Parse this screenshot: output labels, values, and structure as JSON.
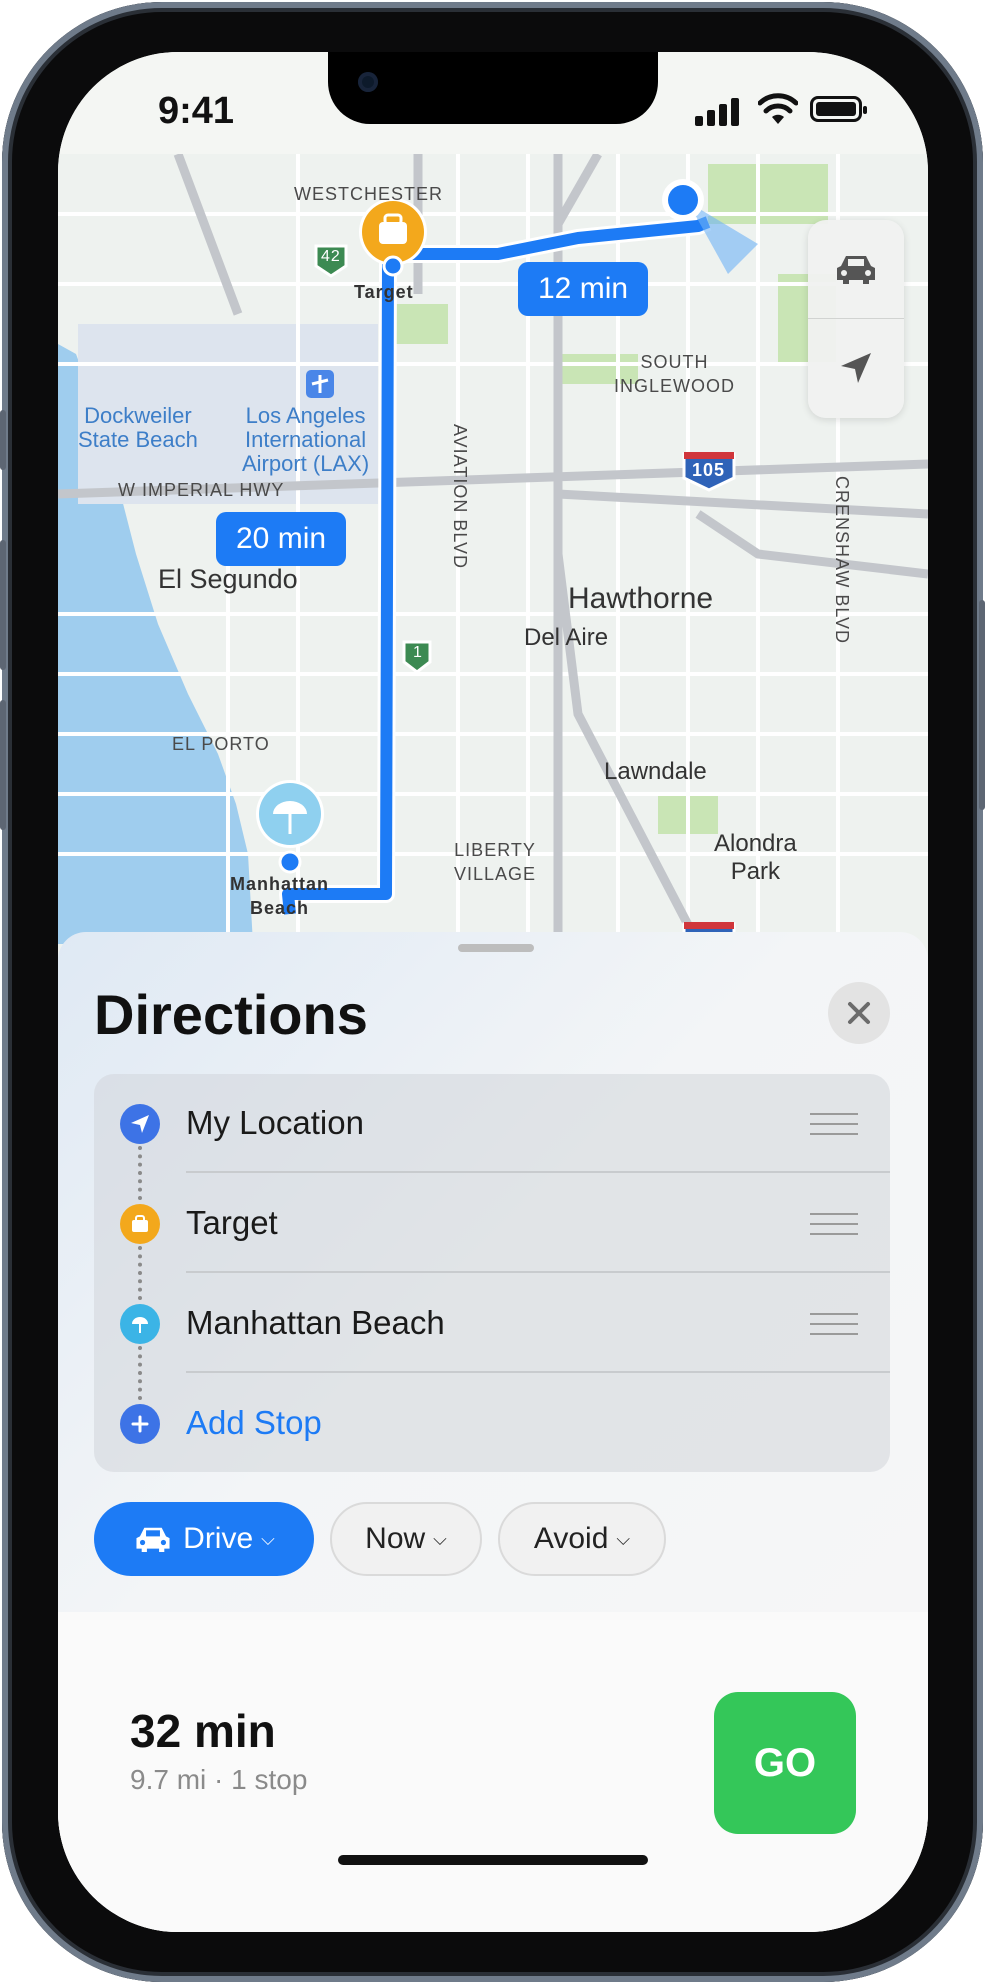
{
  "status": {
    "time": "9:41"
  },
  "map": {
    "labels": {
      "westchester": "WESTCHESTER",
      "target_pin": "Target",
      "south_inglewood": "SOUTH\nINGLEWOOD",
      "dockweiler": "Dockweiler\nState Beach",
      "lax": "Los Angeles\nInternational\nAirport (LAX)",
      "imperial": "W IMPERIAL HWY",
      "el_segundo": "El Segundo",
      "hawthorne": "Hawthorne",
      "del_aire": "Del Aire",
      "el_porto": "EL PORTO",
      "lawndale": "Lawndale",
      "liberty_village": "LIBERTY\nVILLAGE",
      "alondra_park": "Alondra\nPark",
      "manhattan_beach": "Manhattan\nBeach",
      "aviation": "AVIATION BLVD",
      "crenshaw": "CRENSHAW BLVD",
      "shield_42": "42",
      "shield_105": "105",
      "shield_1": "1"
    },
    "bubbles": {
      "leg1": "12 min",
      "leg2": "20 min"
    },
    "colors": {
      "route": "#1d7bf5",
      "water": "#9fcdee",
      "park": "#c9e5b5",
      "land": "#eef2ef"
    }
  },
  "sheet": {
    "title": "Directions",
    "stops": [
      {
        "label": "My Location",
        "icon": "location-arrow-icon",
        "color": "#3d73e6"
      },
      {
        "label": "Target",
        "icon": "shopping-bag-icon",
        "color": "#f3a81c"
      },
      {
        "label": "Manhattan Beach",
        "icon": "beach-umbrella-icon",
        "color": "#3bb4e6"
      }
    ],
    "add_stop": "Add Stop",
    "chips": {
      "drive": "Drive",
      "now": "Now",
      "avoid": "Avoid"
    },
    "route": {
      "eta": "32 min",
      "details": "9.7 mi · 1 stop",
      "go": "GO"
    }
  }
}
